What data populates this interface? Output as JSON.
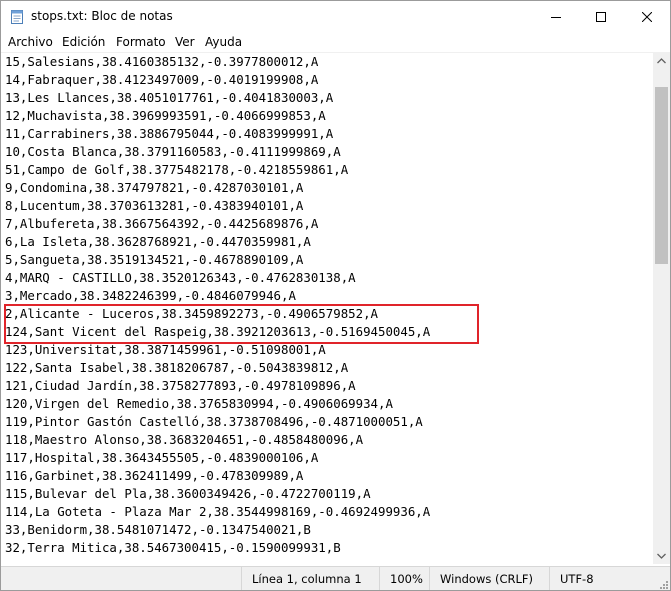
{
  "window": {
    "title": "stops.txt: Bloc de notas",
    "app_icon": "notepad-icon",
    "controls": {
      "minimize_icon": "minimize-icon",
      "maximize_icon": "maximize-icon",
      "close_icon": "close-icon"
    }
  },
  "menubar": {
    "items": [
      "Archivo",
      "Edición",
      "Formato",
      "Ver",
      "Ayuda"
    ]
  },
  "editor": {
    "lines": [
      "15,Salesians,38.4160385132,-0.3977800012,A",
      "14,Fabraquer,38.4123497009,-0.4019199908,A",
      "13,Les Llances,38.4051017761,-0.4041830003,A",
      "12,Muchavista,38.3969993591,-0.4066999853,A",
      "11,Carrabiners,38.3886795044,-0.4083999991,A",
      "10,Costa Blanca,38.3791160583,-0.4111999869,A",
      "51,Campo de Golf,38.3775482178,-0.4218559861,A",
      "9,Condomina,38.374797821,-0.4287030101,A",
      "8,Lucentum,38.3703613281,-0.4383940101,A",
      "7,Albufereta,38.3667564392,-0.4425689876,A",
      "6,La Isleta,38.3628768921,-0.4470359981,A",
      "5,Sangueta,38.3519134521,-0.4678890109,A",
      "4,MARQ - CASTILLO,38.3520126343,-0.4762830138,A",
      "3,Mercado,38.3482246399,-0.4846079946,A",
      "2,Alicante - Luceros,38.3459892273,-0.4906579852,A",
      "124,Sant Vicent del Raspeig,38.3921203613,-0.5169450045,A",
      "123,Universitat,38.3871459961,-0.51098001,A",
      "122,Santa Isabel,38.3818206787,-0.5043839812,A",
      "121,Ciudad Jardín,38.3758277893,-0.4978109896,A",
      "120,Virgen del Remedio,38.3765830994,-0.4906069934,A",
      "119,Pintor Gastón Castelló,38.3738708496,-0.4871000051,A",
      "118,Maestro Alonso,38.3683204651,-0.4858480096,A",
      "117,Hospital,38.3643455505,-0.4839000106,A",
      "116,Garbinet,38.362411499,-0.478309989,A",
      "115,Bulevar del Pla,38.3600349426,-0.4722700119,A",
      "114,La Goteta - Plaza Mar 2,38.3544998169,-0.4692499936,A",
      "33,Benidorm,38.5481071472,-0.1347540021,B",
      "32,Terra Mitica,38.5467300415,-0.1590099931,B"
    ],
    "highlight_color": "#e0242a"
  },
  "statusbar": {
    "position": "Línea 1, columna 1",
    "zoom": "100%",
    "line_endings": "Windows (CRLF)",
    "encoding": "UTF-8"
  }
}
